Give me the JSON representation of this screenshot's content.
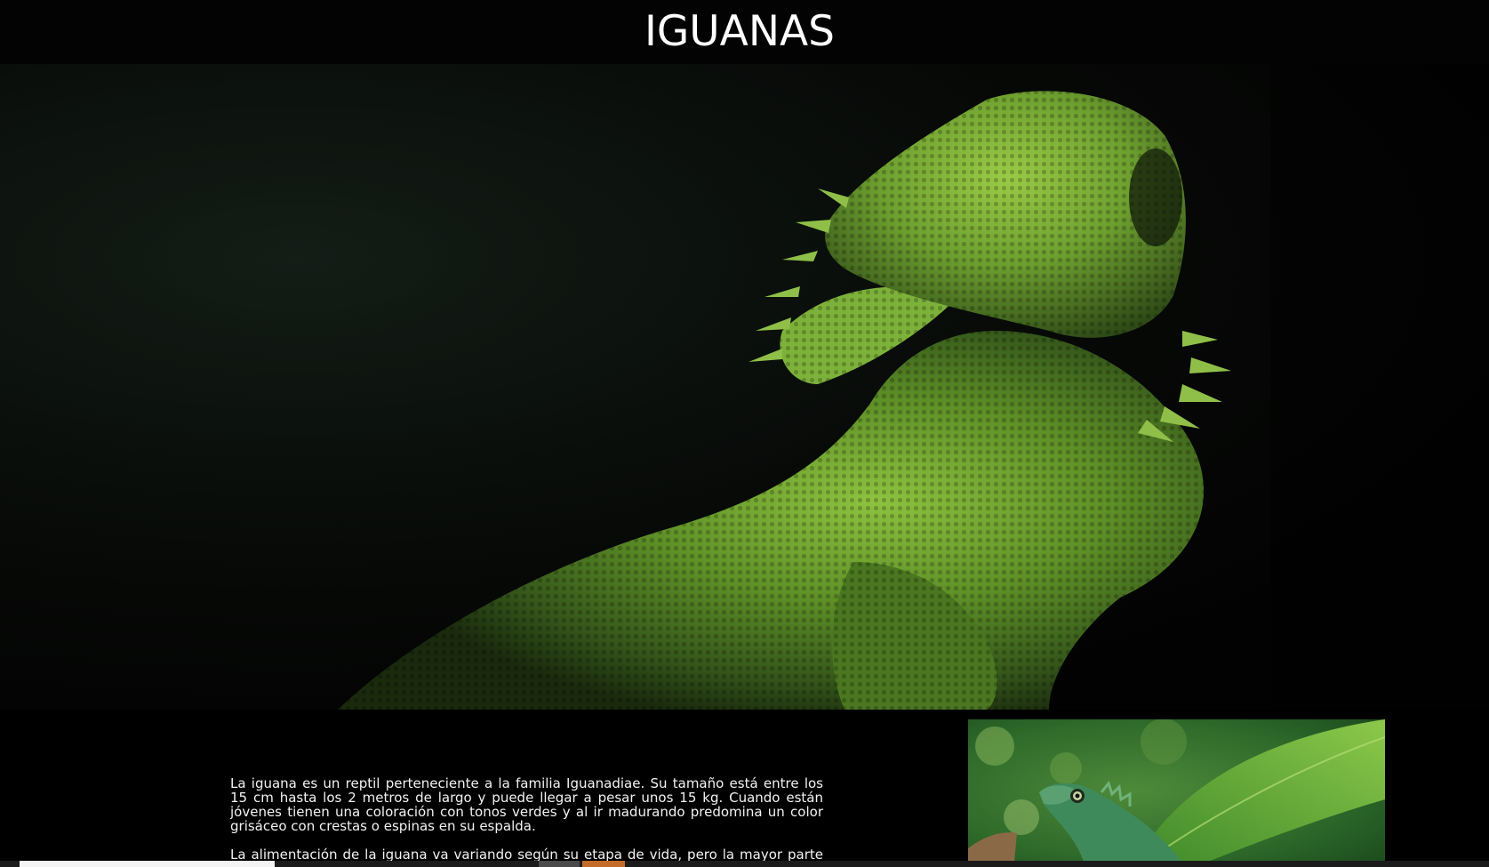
{
  "header": {
    "title": "IGUANAS"
  },
  "hero": {
    "image_subject": "green-iguana-closeup"
  },
  "intro": {
    "paragraphs": [
      "La iguana es un reptil perteneciente a la familia Iguanadiae. Su tamaño está entre los 15 cm hasta los 2 metros de largo y puede llegar a pesar unos 15 kg. Cuando están jóvenes tienen una coloración con tonos verdes y al ir madurando predomina un color grisáceo con crestas o espinas en su espalda.",
      "La alimentación de la iguana va variando según su etapa de vida, pero la mayor parte de"
    ]
  },
  "side_photo": {
    "image_subject": "green-lizard-on-branch"
  },
  "colors": {
    "background": "#000000",
    "header_bg": "#030303",
    "title_text": "#ffffff",
    "body_text": "#f2f2f2",
    "iguana_green": "#6fa22c",
    "chip_gray": "#4a4a4a",
    "chip_orange": "#c46b2a"
  }
}
